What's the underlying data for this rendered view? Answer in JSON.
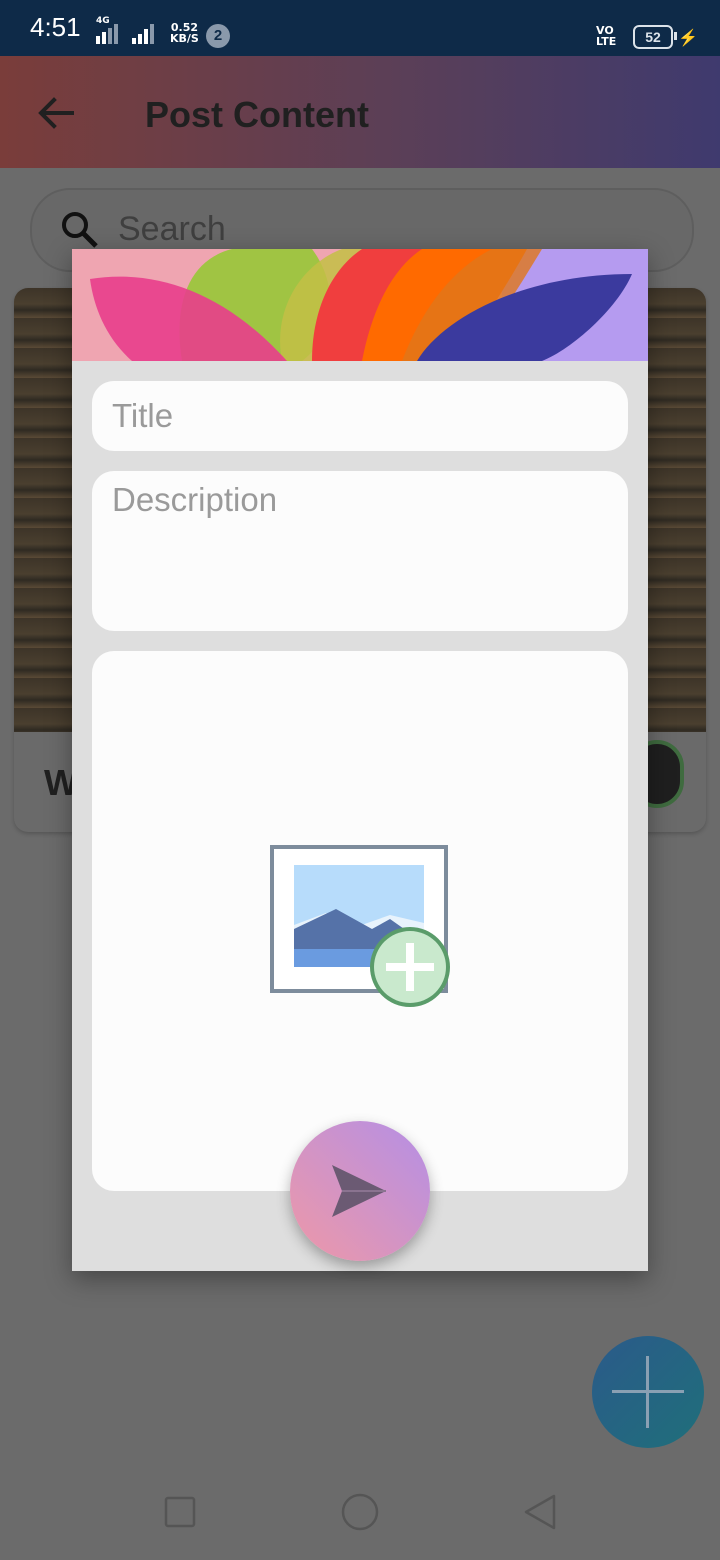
{
  "status_bar": {
    "time": "4:51",
    "network": "4G",
    "speed_value": "0.52",
    "speed_unit": "KB/S",
    "notification_count": "2",
    "volte_top": "VO",
    "volte_bottom": "LTE",
    "battery": "52"
  },
  "app_bar": {
    "title": "Post Content",
    "back_icon": "arrow-back-icon"
  },
  "search": {
    "placeholder": "Search",
    "icon": "search-icon"
  },
  "card": {
    "title_partial": "W"
  },
  "dialog": {
    "title_placeholder": "Title",
    "description_placeholder": "Description",
    "image_picker_icon": "add-image-icon",
    "send_icon": "send-icon",
    "accent_colors": [
      "#e83e8c",
      "#9bc53d",
      "#f03e3e",
      "#ff6a00",
      "#3b3a9e",
      "#b59bf0"
    ]
  },
  "fab_icon": "plus-icon",
  "nav": {
    "recent_icon": "square-icon",
    "home_icon": "circle-icon",
    "back_icon": "triangle-back-icon"
  }
}
